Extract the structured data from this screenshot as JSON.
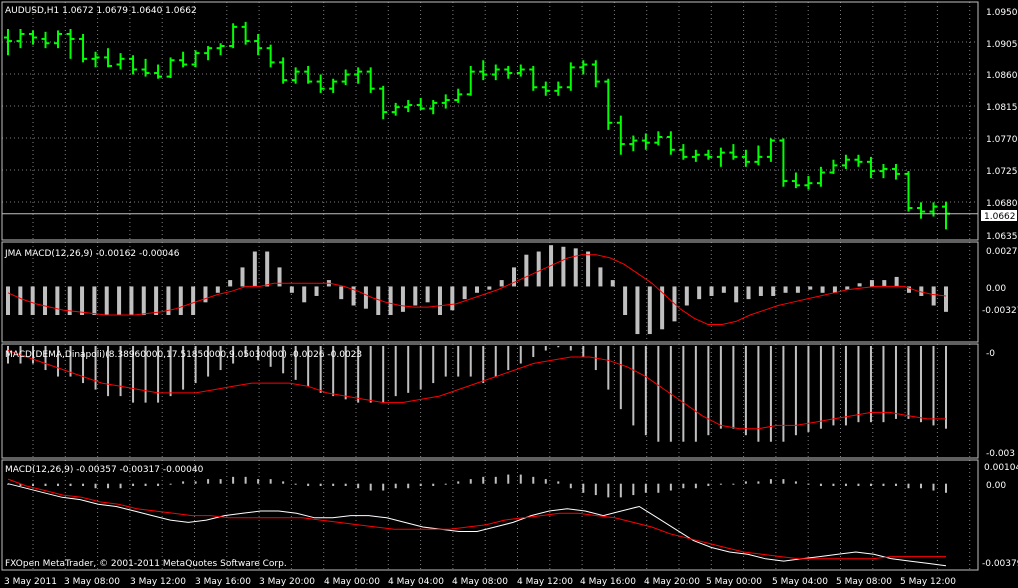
{
  "colors": {
    "background": "#000000",
    "frame": "#c0c0c0",
    "grid": "#808080",
    "bars": "#00ff00",
    "histogram": "#c0c0c0",
    "signal": "#ff0000",
    "macd_line": "#ffffff",
    "price_line": "#c0c0c0"
  },
  "panes": {
    "price": {
      "header": "AUDUSD,H1  1.0672 1.0679 1.0640 1.0662",
      "current_price": "1.0662",
      "scale": [
        "1.0950",
        "1.0905",
        "1.0860",
        "1.0815",
        "1.0770",
        "1.0725",
        "1.0680",
        "1.0635"
      ]
    },
    "jma": {
      "header": "JMA MACD(12,26,9) -0.00162 -0.00046",
      "scale": [
        "0.0027",
        "0.00",
        "-0.00327"
      ]
    },
    "dema": {
      "header": "MACD(DEMA,Dinapoli)(8.38960000,17.51850000,9.05030000) -0.0026 -0.0023",
      "scale": [
        "-0",
        "-0.003"
      ]
    },
    "macd": {
      "header": "MACD(12,26,9) -0.00357 -0.00317 -0.00040",
      "scale": [
        "0.00104",
        "0.00",
        "-0.00379"
      ],
      "copyright": "FXOpen MetaTrader, © 2001-2011 MetaQuotes Software Corp."
    }
  },
  "time_labels": [
    "3 May 2011",
    "3 May 08:00",
    "3 May 12:00",
    "3 May 16:00",
    "3 May 20:00",
    "4 May 00:00",
    "4 May 04:00",
    "4 May 08:00",
    "4 May 12:00",
    "4 May 16:00",
    "4 May 20:00",
    "5 May 00:00",
    "5 May 04:00",
    "5 May 08:00",
    "5 May 12:00"
  ],
  "chart_data": [
    {
      "type": "bar",
      "title": "AUDUSD,H1",
      "ohlc_last": {
        "open": 1.0672,
        "high": 1.0679,
        "low": 1.064,
        "close": 1.0662
      },
      "ylim": [
        1.0625,
        1.096
      ],
      "y_ticks": [
        1.095,
        1.0905,
        1.086,
        1.0815,
        1.077,
        1.0725,
        1.068,
        1.0635
      ],
      "bars": [
        {
          "open": 1.091,
          "high": 1.0922,
          "low": 1.0885,
          "close": 1.0905
        },
        {
          "open": 1.0905,
          "high": 1.0922,
          "low": 1.0895,
          "close": 1.0915
        },
        {
          "open": 1.0915,
          "high": 1.092,
          "low": 1.09,
          "close": 1.091
        },
        {
          "open": 1.0908,
          "high": 1.0918,
          "low": 1.0895,
          "close": 1.0902
        },
        {
          "open": 1.0902,
          "high": 1.092,
          "low": 1.0895,
          "close": 1.0915
        },
        {
          "open": 1.0915,
          "high": 1.0922,
          "low": 1.088,
          "close": 1.0908
        },
        {
          "open": 1.0908,
          "high": 1.0915,
          "low": 1.0875,
          "close": 1.088
        },
        {
          "open": 1.088,
          "high": 1.089,
          "low": 1.0868,
          "close": 1.0882
        },
        {
          "open": 1.0882,
          "high": 1.0895,
          "low": 1.0868,
          "close": 1.087
        },
        {
          "open": 1.0872,
          "high": 1.0888,
          "low": 1.0865,
          "close": 1.088
        },
        {
          "open": 1.088,
          "high": 1.0885,
          "low": 1.0858,
          "close": 1.0865
        },
        {
          "open": 1.0865,
          "high": 1.088,
          "low": 1.0855,
          "close": 1.086
        },
        {
          "open": 1.086,
          "high": 1.0872,
          "low": 1.0852,
          "close": 1.0855
        },
        {
          "open": 1.0855,
          "high": 1.0882,
          "low": 1.0853,
          "close": 1.0878
        },
        {
          "open": 1.0878,
          "high": 1.089,
          "low": 1.0868,
          "close": 1.0872
        },
        {
          "open": 1.0872,
          "high": 1.0892,
          "low": 1.0868,
          "close": 1.0888
        },
        {
          "open": 1.0888,
          "high": 1.0898,
          "low": 1.0878,
          "close": 1.0895
        },
        {
          "open": 1.0895,
          "high": 1.0902,
          "low": 1.0885,
          "close": 1.0898
        },
        {
          "open": 1.0898,
          "high": 1.093,
          "low": 1.0895,
          "close": 1.0925
        },
        {
          "open": 1.0925,
          "high": 1.0932,
          "low": 1.09,
          "close": 1.0905
        },
        {
          "open": 1.0905,
          "high": 1.0915,
          "low": 1.0885,
          "close": 1.0895
        },
        {
          "open": 1.0895,
          "high": 1.09,
          "low": 1.0868,
          "close": 1.0875
        },
        {
          "open": 1.0875,
          "high": 1.0882,
          "low": 1.0845,
          "close": 1.085
        },
        {
          "open": 1.085,
          "high": 1.0868,
          "low": 1.0845,
          "close": 1.0862
        },
        {
          "open": 1.0862,
          "high": 1.087,
          "low": 1.0845,
          "close": 1.0848
        },
        {
          "open": 1.0848,
          "high": 1.0858,
          "low": 1.0832,
          "close": 1.0838
        },
        {
          "open": 1.0838,
          "high": 1.0852,
          "low": 1.0832,
          "close": 1.0848
        },
        {
          "open": 1.0848,
          "high": 1.0865,
          "low": 1.0843,
          "close": 1.0858
        },
        {
          "open": 1.0858,
          "high": 1.0868,
          "low": 1.0845,
          "close": 1.0862
        },
        {
          "open": 1.0862,
          "high": 1.0868,
          "low": 1.0832,
          "close": 1.0838
        },
        {
          "open": 1.0838,
          "high": 1.0842,
          "low": 1.0795,
          "close": 1.0805
        },
        {
          "open": 1.0805,
          "high": 1.0818,
          "low": 1.08,
          "close": 1.0812
        },
        {
          "open": 1.0812,
          "high": 1.0822,
          "low": 1.0805,
          "close": 1.0815
        },
        {
          "open": 1.0815,
          "high": 1.0825,
          "low": 1.0808,
          "close": 1.081
        },
        {
          "open": 1.081,
          "high": 1.0822,
          "low": 1.0802,
          "close": 1.0818
        },
        {
          "open": 1.0818,
          "high": 1.083,
          "low": 1.081,
          "close": 1.0822
        },
        {
          "open": 1.0822,
          "high": 1.0838,
          "low": 1.0818,
          "close": 1.083
        },
        {
          "open": 1.083,
          "high": 1.087,
          "low": 1.0828,
          "close": 1.0862
        },
        {
          "open": 1.0862,
          "high": 1.0878,
          "low": 1.085,
          "close": 1.0858
        },
        {
          "open": 1.0858,
          "high": 1.0872,
          "low": 1.085,
          "close": 1.0865
        },
        {
          "open": 1.0865,
          "high": 1.087,
          "low": 1.0852,
          "close": 1.086
        },
        {
          "open": 1.086,
          "high": 1.0872,
          "low": 1.0855,
          "close": 1.0865
        },
        {
          "open": 1.0865,
          "high": 1.087,
          "low": 1.0835,
          "close": 1.084
        },
        {
          "open": 1.084,
          "high": 1.0848,
          "low": 1.0828,
          "close": 1.0835
        },
        {
          "open": 1.0835,
          "high": 1.0848,
          "low": 1.0828,
          "close": 1.084
        },
        {
          "open": 1.084,
          "high": 1.0875,
          "low": 1.0835,
          "close": 1.0868
        },
        {
          "open": 1.0868,
          "high": 1.0878,
          "low": 1.0858,
          "close": 1.0872
        },
        {
          "open": 1.0872,
          "high": 1.0878,
          "low": 1.084,
          "close": 1.0848
        },
        {
          "open": 1.0848,
          "high": 1.0852,
          "low": 1.078,
          "close": 1.079
        },
        {
          "open": 1.079,
          "high": 1.08,
          "low": 1.0745,
          "close": 1.076
        },
        {
          "open": 1.076,
          "high": 1.0772,
          "low": 1.075,
          "close": 1.0765
        },
        {
          "open": 1.0765,
          "high": 1.0775,
          "low": 1.0752,
          "close": 1.0762
        },
        {
          "open": 1.0762,
          "high": 1.0778,
          "low": 1.0758,
          "close": 1.077
        },
        {
          "open": 1.077,
          "high": 1.0778,
          "low": 1.0745,
          "close": 1.0752
        },
        {
          "open": 1.0752,
          "high": 1.076,
          "low": 1.0738,
          "close": 1.0742
        },
        {
          "open": 1.0742,
          "high": 1.0752,
          "low": 1.0735,
          "close": 1.0745
        },
        {
          "open": 1.0745,
          "high": 1.0752,
          "low": 1.0738,
          "close": 1.0742
        },
        {
          "open": 1.0742,
          "high": 1.0755,
          "low": 1.0728,
          "close": 1.0748
        },
        {
          "open": 1.0748,
          "high": 1.076,
          "low": 1.0738,
          "close": 1.0742
        },
        {
          "open": 1.0742,
          "high": 1.0752,
          "low": 1.0728,
          "close": 1.0735
        },
        {
          "open": 1.0735,
          "high": 1.0758,
          "low": 1.073,
          "close": 1.0742
        },
        {
          "open": 1.0742,
          "high": 1.0768,
          "low": 1.0735,
          "close": 1.0765
        },
        {
          "open": 1.0765,
          "high": 1.0768,
          "low": 1.07,
          "close": 1.0708
        },
        {
          "open": 1.0708,
          "high": 1.072,
          "low": 1.0698,
          "close": 1.0702
        },
        {
          "open": 1.0702,
          "high": 1.0715,
          "low": 1.0696,
          "close": 1.0705
        },
        {
          "open": 1.0705,
          "high": 1.0728,
          "low": 1.07,
          "close": 1.072
        },
        {
          "open": 1.072,
          "high": 1.0738,
          "low": 1.0718,
          "close": 1.073
        },
        {
          "open": 1.073,
          "high": 1.0745,
          "low": 1.0725,
          "close": 1.0738
        },
        {
          "open": 1.0738,
          "high": 1.0745,
          "low": 1.0728,
          "close": 1.0735
        },
        {
          "open": 1.0735,
          "high": 1.0742,
          "low": 1.0712,
          "close": 1.0722
        },
        {
          "open": 1.0722,
          "high": 1.0732,
          "low": 1.0712,
          "close": 1.0725
        },
        {
          "open": 1.0725,
          "high": 1.0732,
          "low": 1.071,
          "close": 1.0718
        },
        {
          "open": 1.0718,
          "high": 1.0722,
          "low": 1.0665,
          "close": 1.067
        },
        {
          "open": 1.067,
          "high": 1.0678,
          "low": 1.0655,
          "close": 1.0665
        },
        {
          "open": 1.0665,
          "high": 1.0678,
          "low": 1.0658,
          "close": 1.0672
        },
        {
          "open": 1.0672,
          "high": 1.0679,
          "low": 1.064,
          "close": 1.0662
        }
      ]
    },
    {
      "type": "bar",
      "title": "JMA MACD(12,26,9)",
      "ylim": [
        -0.0035,
        0.0028
      ],
      "histogram": [
        -0.0018,
        -0.0018,
        -0.0018,
        -0.0018,
        -0.0018,
        -0.0018,
        -0.0018,
        -0.0018,
        -0.0018,
        -0.0018,
        -0.0018,
        -0.0018,
        -0.0018,
        -0.0018,
        -0.0018,
        -0.0018,
        -0.001,
        -0.0004,
        0.0004,
        0.0012,
        0.0022,
        0.0022,
        0.0012,
        -0.0004,
        -0.001,
        -0.0006,
        0.0004,
        -0.0008,
        -0.0012,
        -0.0014,
        -0.0018,
        -0.0018,
        -0.0016,
        -0.0012,
        -0.001,
        -0.0018,
        -0.0015,
        -0.0008,
        -0.0004,
        -0.0002,
        0.0004,
        0.0012,
        0.002,
        0.0022,
        0.0026,
        0.0025,
        0.0024,
        0.0022,
        0.0012,
        0.0004,
        -0.0018,
        -0.003,
        -0.003,
        -0.0027,
        -0.0022,
        -0.0012,
        -0.0008,
        -0.0006,
        -0.0004,
        -0.001,
        -0.0008,
        -0.0006,
        -0.0006,
        -0.0004,
        -0.0004,
        -0.0002,
        -0.0004,
        -0.0004,
        -0.0002,
        0.0002,
        0.0004,
        0.0004,
        0.0006,
        -0.0004,
        -0.0006,
        -0.0012,
        -0.0016
      ],
      "signal": [
        -0.0004,
        -0.0008,
        -0.0011,
        -0.0013,
        -0.0015,
        -0.0016,
        -0.0017,
        -0.0018,
        -0.0018,
        -0.0018,
        -0.0017,
        -0.0016,
        -0.0014,
        -0.0011,
        -0.0008,
        -0.0005,
        -0.0003,
        0.0,
        0.0,
        0.0002,
        0.0002,
        0.0002,
        0.0002,
        0.0002,
        0.0,
        -0.0003,
        -0.0007,
        -0.001,
        -0.0012,
        -0.0013,
        -0.0013,
        -0.0012,
        -0.0011,
        -0.0008,
        -0.0005,
        -0.0002,
        0.0002,
        0.0006,
        0.001,
        0.0014,
        0.0018,
        0.002,
        0.002,
        0.0018,
        0.0014,
        0.0008,
        0.0002,
        -0.0006,
        -0.0014,
        -0.002,
        -0.0024,
        -0.0024,
        -0.0022,
        -0.0018,
        -0.0015,
        -0.0012,
        -0.001,
        -0.0008,
        -0.0006,
        -0.0004,
        -0.0002,
        -0.0001,
        0.0,
        0.0,
        0.0,
        -0.0003,
        -0.0005,
        -0.0006
      ],
      "current_values": [
        -0.00162,
        -0.00046
      ]
    },
    {
      "type": "bar",
      "title": "MACD(DEMA,Dinapoli)(8.38960000,17.51850000,9.05030000)",
      "ylim": [
        -0.0035,
        0.0
      ],
      "histogram": [
        -0.0006,
        -0.0006,
        -0.0006,
        -0.0008,
        -0.001,
        -0.001,
        -0.0012,
        -0.0014,
        -0.0016,
        -0.0016,
        -0.0018,
        -0.0018,
        -0.0018,
        -0.0016,
        -0.0014,
        -0.0012,
        -0.001,
        -0.0008,
        -0.0006,
        -0.0004,
        -0.0005,
        -0.0007,
        -0.0009,
        -0.0011,
        -0.0013,
        -0.0015,
        -0.0016,
        -0.0017,
        -0.0018,
        -0.0018,
        -0.0018,
        -0.0016,
        -0.0015,
        -0.0014,
        -0.0012,
        -0.001,
        -0.001,
        -0.001,
        -0.0012,
        -0.001,
        -0.0008,
        -0.0006,
        -0.0004,
        -0.0002,
        -0.0001,
        -0.0002,
        -0.0004,
        -0.0008,
        -0.0014,
        -0.002,
        -0.0025,
        -0.0028,
        -0.003,
        -0.003,
        -0.003,
        -0.003,
        -0.0028,
        -0.0026,
        -0.0026,
        -0.0028,
        -0.003,
        -0.003,
        -0.003,
        -0.0028,
        -0.0027,
        -0.0026,
        -0.0025,
        -0.0025,
        -0.0024,
        -0.0024,
        -0.0024,
        -0.0023,
        -0.0023,
        -0.0024,
        -0.0025,
        -0.0026
      ],
      "signal": [
        -0.0002,
        -0.0004,
        -0.0006,
        -0.0008,
        -0.001,
        -0.0012,
        -0.0013,
        -0.0014,
        -0.0015,
        -0.0015,
        -0.0015,
        -0.0014,
        -0.0013,
        -0.0012,
        -0.0012,
        -0.0012,
        -0.0013,
        -0.0015,
        -0.0016,
        -0.0017,
        -0.0018,
        -0.0018,
        -0.0017,
        -0.0016,
        -0.0014,
        -0.0012,
        -0.001,
        -0.0008,
        -0.0006,
        -0.0005,
        -0.0004,
        -0.0004,
        -0.0005,
        -0.0007,
        -0.001,
        -0.0014,
        -0.0018,
        -0.0022,
        -0.0025,
        -0.0026,
        -0.0026,
        -0.0025,
        -0.0025,
        -0.0024,
        -0.0023,
        -0.0022,
        -0.0021,
        -0.0021,
        -0.0022,
        -0.0023,
        -0.0023
      ],
      "current_values": [
        -0.0026,
        -0.0023
      ]
    },
    {
      "type": "line",
      "title": "MACD(12,26,9)",
      "ylim": [
        -0.00379,
        0.00104
      ],
      "histogram": [
        0.0,
        -0.0001,
        -0.0001,
        -0.0001,
        -0.0001,
        -0.0001,
        -0.0001,
        -0.0002,
        -0.0002,
        -0.0002,
        -0.0001,
        -0.0001,
        -0.0001,
        0.0,
        0.0001,
        0.0001,
        0.0002,
        0.0002,
        0.0003,
        0.0003,
        0.0002,
        0.0002,
        0.0001,
        0.0,
        -0.0001,
        -0.0001,
        -0.0001,
        -0.0001,
        -0.0002,
        -0.0003,
        -0.0003,
        -0.0002,
        -0.0002,
        -0.0001,
        -0.0001,
        0.0,
        0.0001,
        0.0002,
        0.0003,
        0.0003,
        0.0004,
        0.0004,
        0.0003,
        0.0002,
        0.0001,
        -0.0002,
        -0.0004,
        -0.0005,
        -0.0006,
        -0.0006,
        -0.0005,
        -0.0004,
        -0.0004,
        -0.0003,
        -0.0002,
        -0.0002,
        -0.0001,
        0.0,
        0.0,
        0.0001,
        0.0001,
        0.0002,
        0.0002,
        0.0001,
        0.0,
        -0.0001,
        -0.0001,
        -0.0001,
        -0.0001,
        -0.0001,
        -0.0001,
        -0.0001,
        -0.0002,
        -0.0002,
        -0.0003,
        -0.0004
      ],
      "macd": [
        0.0,
        -0.0002,
        -0.0004,
        -0.0006,
        -0.0007,
        -0.0009,
        -0.001,
        -0.0012,
        -0.0014,
        -0.0016,
        -0.0017,
        -0.0016,
        -0.0014,
        -0.0013,
        -0.0012,
        -0.0012,
        -0.0013,
        -0.0015,
        -0.0015,
        -0.0014,
        -0.0014,
        -0.0015,
        -0.0017,
        -0.0019,
        -0.002,
        -0.0021,
        -0.0021,
        -0.0019,
        -0.0017,
        -0.0014,
        -0.0012,
        -0.0011,
        -0.0012,
        -0.0014,
        -0.0012,
        -0.001,
        -0.0015,
        -0.002,
        -0.0025,
        -0.0028,
        -0.003,
        -0.0031,
        -0.0033,
        -0.0034,
        -0.0033,
        -0.0032,
        -0.0031,
        -0.003,
        -0.0031,
        -0.0033,
        -0.0034,
        -0.0035,
        -0.0036
      ],
      "signal": [
        0.0002,
        -0.0001,
        -0.0003,
        -0.0005,
        -0.0006,
        -0.0008,
        -0.0009,
        -0.0011,
        -0.0012,
        -0.0013,
        -0.0014,
        -0.0014,
        -0.0015,
        -0.0015,
        -0.0015,
        -0.0015,
        -0.0015,
        -0.0016,
        -0.0017,
        -0.0018,
        -0.0019,
        -0.002,
        -0.002,
        -0.002,
        -0.002,
        -0.0019,
        -0.0018,
        -0.0016,
        -0.0015,
        -0.0014,
        -0.0013,
        -0.0013,
        -0.0014,
        -0.0015,
        -0.0017,
        -0.0019,
        -0.0022,
        -0.0024,
        -0.0026,
        -0.0028,
        -0.003,
        -0.0031,
        -0.0032,
        -0.0033,
        -0.0033,
        -0.0033,
        -0.0033,
        -0.0033,
        -0.0032,
        -0.0032,
        -0.0032,
        -0.0032
      ],
      "current_values": [
        -0.00357,
        -0.00317,
        -0.0004
      ]
    }
  ]
}
